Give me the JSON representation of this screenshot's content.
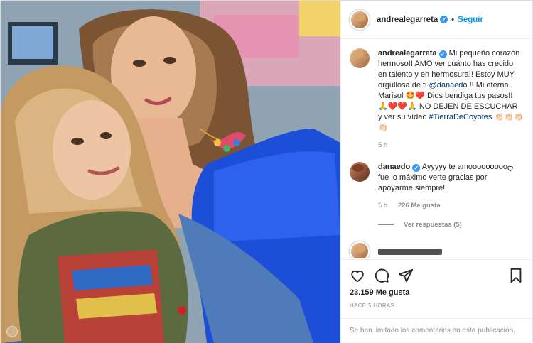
{
  "post": {
    "author": "andrealegarreta",
    "follow_label": "Seguir",
    "separator": "•"
  },
  "caption": {
    "username": "andrealegarreta",
    "text_1": "Mi pequeño corazón hermoso!! AMO ver cuánto has crecido en talento y en hermosura!! Estoy MUY orgullosa de ti ",
    "mention": "@danaedo",
    "text_2": " !! Mi eterna Marisol 🤩❤️ Dios bendiga tus pasos!! 🙏❤️❤️🙏 NO DEJEN DE ESCUCHAR y ver su vídeo ",
    "hashtag": "#TierraDeCoyotes",
    "text_3": " 👏🏻👏🏻👏🏻👏🏻",
    "time": "5 h"
  },
  "comment": {
    "username": "danaedo",
    "text": "Ayyyyy te amooooooooo fue lo máximo verte gracias por apoyarme siempre!",
    "time": "5 h",
    "likes": "226 Me gusta",
    "replies_label": "Ver respuestas (5)"
  },
  "actions": {
    "likes": "23.159 Me gusta",
    "timestamp": "HACE 5 HORAS"
  },
  "footer": {
    "limited_text": "Se han limitado los comentarios en esta publicación."
  },
  "icons": [
    "heart-icon",
    "comment-icon",
    "share-icon",
    "bookmark-icon",
    "verified-icon"
  ]
}
